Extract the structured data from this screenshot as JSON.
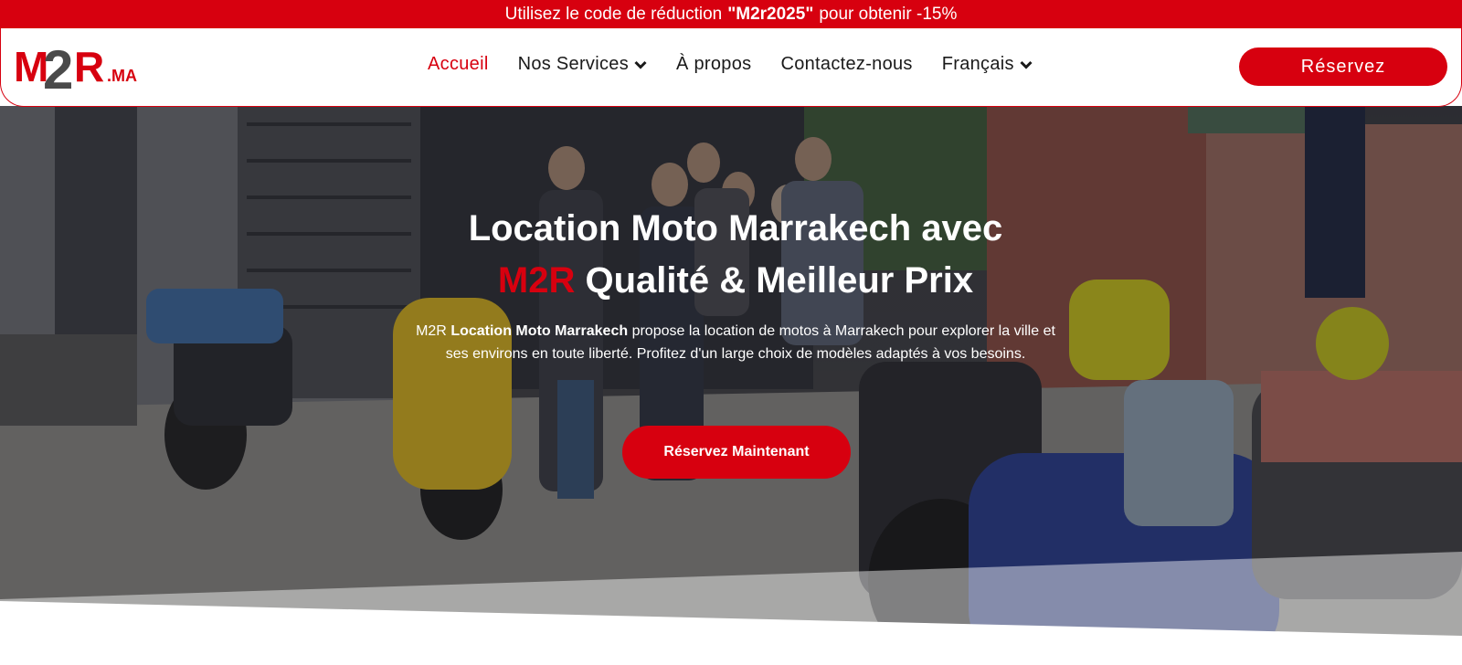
{
  "promo": {
    "prefix": "Utilisez le code de réduction",
    "code": "\"M2r2025\"",
    "suffix": "pour obtenir -15%"
  },
  "header": {
    "logo_text": "M2R",
    "logo_suffix": ".MA",
    "nav": [
      {
        "label": "Accueil",
        "active": true,
        "has_dropdown": false
      },
      {
        "label": "Nos Services",
        "active": false,
        "has_dropdown": true
      },
      {
        "label": "À propos",
        "active": false,
        "has_dropdown": false
      },
      {
        "label": "Contactez-nous",
        "active": false,
        "has_dropdown": false
      },
      {
        "label": "Français",
        "active": false,
        "has_dropdown": true
      }
    ],
    "reserve_label": "Réservez"
  },
  "hero": {
    "title_line1": "Location Moto Marrakech avec",
    "title_brand": "M2R",
    "title_line2_rest": " Qualité & Meilleur Prix",
    "desc_part1": "M2R ",
    "desc_bold": "Location Moto Marrakech",
    "desc_part2": " propose la location de motos à Marrakech pour explorer la ville et ses environs en toute liberté. Profitez d'un large choix de modèles adaptés à vos besoins.",
    "cta_label": "Réservez Maintenant"
  },
  "colors": {
    "accent": "#d7000f",
    "text_dark": "#1a1a1a",
    "white": "#ffffff"
  },
  "icons": {
    "dropdown": "chevron-down-icon"
  }
}
